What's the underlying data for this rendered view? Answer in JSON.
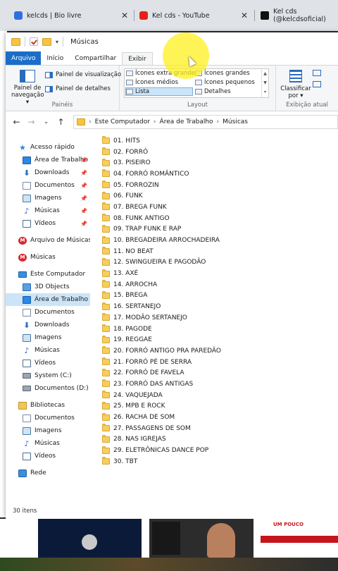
{
  "browser": {
    "tabs": [
      {
        "title": "kelcds | Bio livre",
        "icon": "link-icon"
      },
      {
        "title": "Kel cds - YouTube",
        "icon": "youtube-icon"
      },
      {
        "title": "Kel cds (@kelcdsoficial)",
        "icon": "tiktok-icon"
      }
    ],
    "close_glyph": "✕"
  },
  "window": {
    "title": "Músicas"
  },
  "ribbon": {
    "tabs": [
      "Arquivo",
      "Início",
      "Compartilhar",
      "Exibir"
    ],
    "active_tab": "Exibir",
    "panes_group": {
      "name": "Painéis",
      "nav_pane_line1": "Painel de",
      "nav_pane_line2": "navegação ▾",
      "preview_pane": "Painel de visualização",
      "details_pane": "Painel de detalhes"
    },
    "layout_group": {
      "name": "Layout",
      "options": [
        "Ícones extra grandes",
        "Ícones grandes",
        "Ícones médios",
        "Ícones pequenos",
        "Lista",
        "Detalhes"
      ],
      "selected": "Lista"
    },
    "current_view_group": {
      "name": "Exibição atual",
      "sort_line1": "Classificar",
      "sort_line2": "por ▾"
    }
  },
  "address": {
    "back": "←",
    "forward": "→",
    "recent": "⌄",
    "up": "↑",
    "path": [
      "Este Computador",
      "Área de Trabalho",
      "Músicas"
    ],
    "separator": "›"
  },
  "nav_pane": {
    "quick_access": {
      "label": "Acesso rápido",
      "items": [
        {
          "label": "Área de Trabalho",
          "icon": "desktop-icon"
        },
        {
          "label": "Downloads",
          "icon": "download-icon"
        },
        {
          "label": "Documentos",
          "icon": "documents-icon"
        },
        {
          "label": "Imagens",
          "icon": "pictures-icon"
        },
        {
          "label": "Músicas",
          "icon": "music-icon"
        },
        {
          "label": "Vídeos",
          "icon": "videos-icon"
        }
      ]
    },
    "mega_items": [
      "Arquivo de Músicas",
      "Músicas"
    ],
    "this_pc": {
      "label": "Este Computador",
      "items": [
        {
          "label": "3D Objects",
          "icon": "3d-objects-icon"
        },
        {
          "label": "Área de Trabalho",
          "icon": "desktop-icon",
          "selected": true
        },
        {
          "label": "Documentos",
          "icon": "documents-icon"
        },
        {
          "label": "Downloads",
          "icon": "download-icon"
        },
        {
          "label": "Imagens",
          "icon": "pictures-icon"
        },
        {
          "label": "Músicas",
          "icon": "music-icon"
        },
        {
          "label": "Vídeos",
          "icon": "videos-icon"
        },
        {
          "label": "System (C:)",
          "icon": "drive-icon"
        },
        {
          "label": "Documentos (D:)",
          "icon": "drive-icon"
        }
      ]
    },
    "libraries": {
      "label": "Bibliotecas",
      "items": [
        {
          "label": "Documentos",
          "icon": "documents-icon"
        },
        {
          "label": "Imagens",
          "icon": "pictures-icon"
        },
        {
          "label": "Músicas",
          "icon": "music-icon"
        },
        {
          "label": "Vídeos",
          "icon": "videos-icon"
        }
      ]
    },
    "network": "Rede"
  },
  "files": [
    "01. HITS",
    "02. FORRÓ",
    "03. PISEIRO",
    "04. FORRÓ ROMÂNTICO",
    "05. FORROZIN",
    "06. FUNK",
    "07. BREGA FUNK",
    "08. FUNK ANTIGO",
    "09. TRAP FUNK E RAP",
    "10. BREGADEIRA ARROCHADEIRA",
    "11. NO BEAT",
    "12. SWINGUEIRA E PAGODÃO",
    "13. AXÉ",
    "14. ARROCHA",
    "15. BREGA",
    "16. SERTANEJO",
    "17. MODÃO SERTANEJO",
    "18. PAGODE",
    "19. REGGAE",
    "20. FORRÓ ANTIGO PRA PAREDÃO",
    "21. FORRÓ PÉ DE SERRA",
    "22. FORRÓ DE FAVELA",
    "23. FORRÓ DAS ANTIGAS",
    "24. VAQUEJADA",
    "25. MPB E ROCK",
    "26. RACHA DE SOM",
    "27. PASSAGENS DE SOM",
    "28. NAS IGREJAS",
    "29. ELETRÔNICAS DANCE POP",
    "30. TBT"
  ],
  "status": "30 itens",
  "page_below": {
    "thumb3_title": "UM POUCO"
  }
}
